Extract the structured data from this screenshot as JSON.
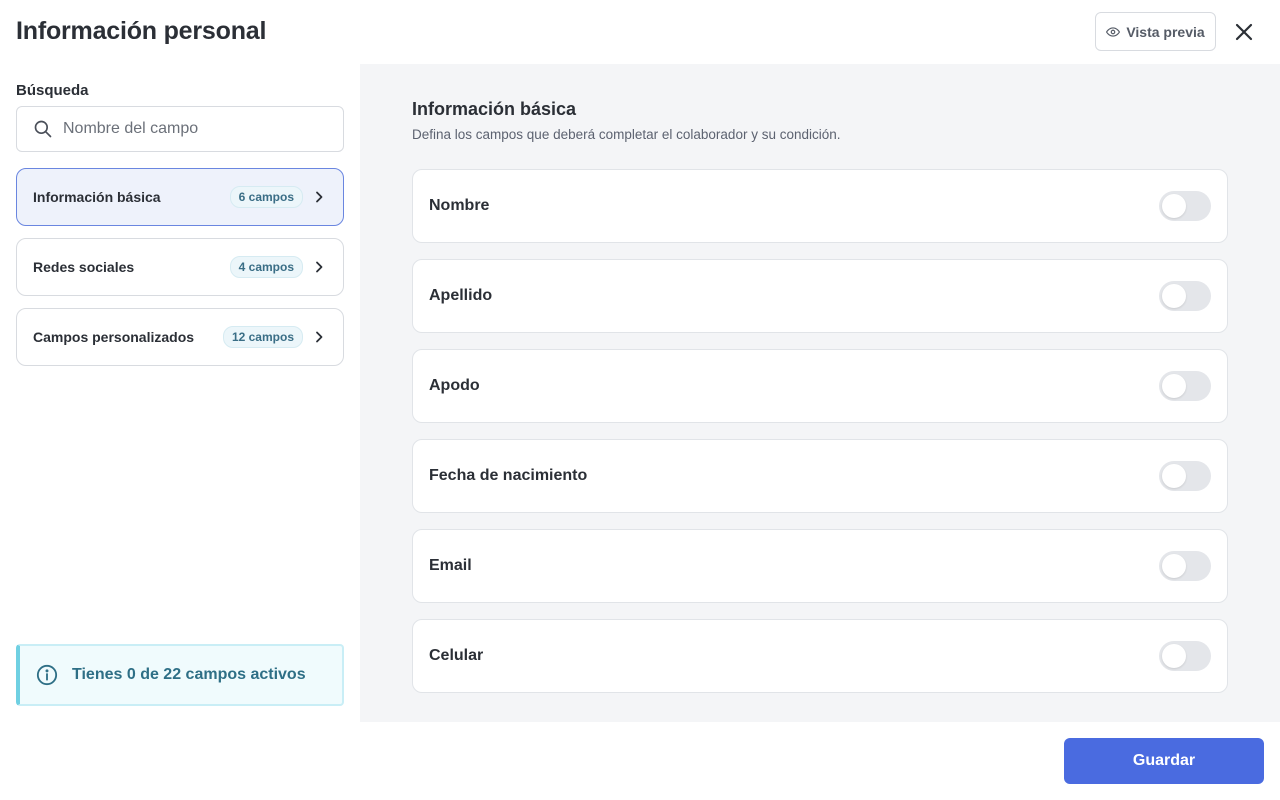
{
  "header": {
    "title": "Información personal",
    "preview_label": "Vista previa"
  },
  "sidebar": {
    "search_label": "Búsqueda",
    "search_placeholder": "Nombre del campo",
    "search_value": "",
    "categories": [
      {
        "label": "Información básica",
        "badge": "6 campos",
        "active": true
      },
      {
        "label": "Redes sociales",
        "badge": "4 campos",
        "active": false
      },
      {
        "label": "Campos personalizados",
        "badge": "12 campos",
        "active": false
      }
    ],
    "info_text": "Tienes 0 de 22 campos activos"
  },
  "main": {
    "section_title": "Información básica",
    "section_desc": "Defina los campos que deberá completar el colaborador y su condición.",
    "fields": [
      {
        "label": "Nombre",
        "enabled": false
      },
      {
        "label": "Apellido",
        "enabled": false
      },
      {
        "label": "Apodo",
        "enabled": false
      },
      {
        "label": "Fecha de nacimiento",
        "enabled": false
      },
      {
        "label": "Email",
        "enabled": false
      },
      {
        "label": "Celular",
        "enabled": false
      }
    ]
  },
  "footer": {
    "save_label": "Guardar"
  },
  "colors": {
    "primary": "#4a6be0",
    "info_accent": "#6fd0e2",
    "main_bg": "#f4f5f7"
  }
}
